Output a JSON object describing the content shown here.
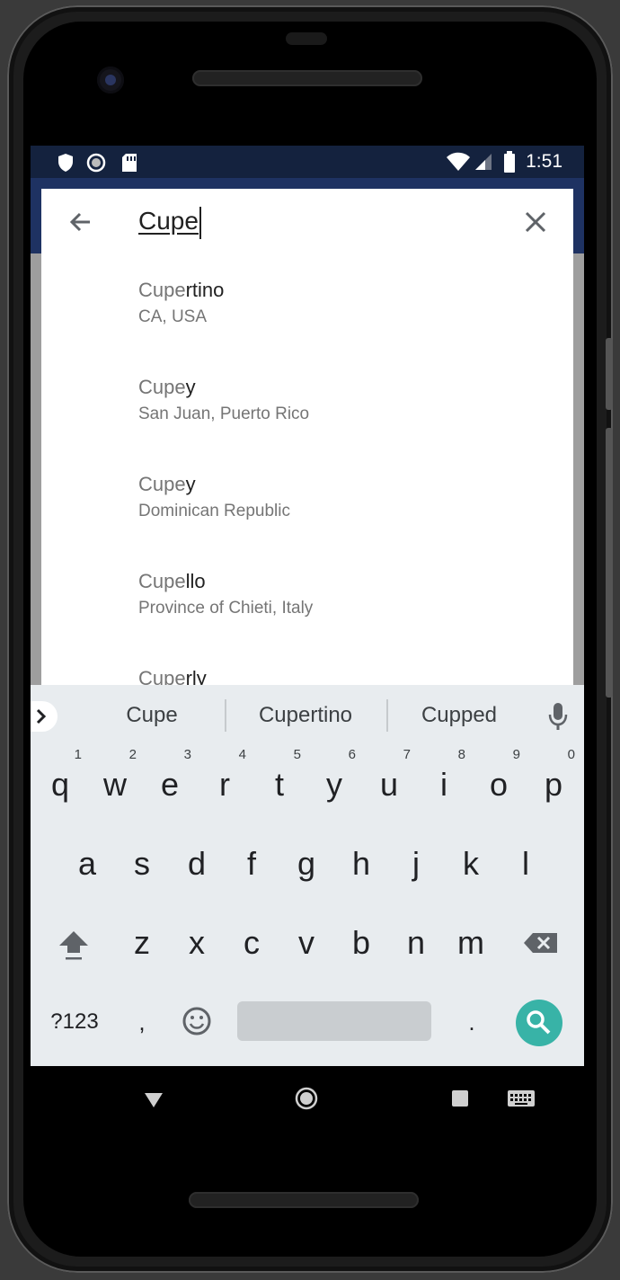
{
  "status_bar": {
    "time": "1:51",
    "left_icons": [
      "shield-icon",
      "sync-icon",
      "sd-card-icon"
    ],
    "right_icons": [
      "wifi-icon",
      "cell-signal-icon",
      "battery-icon"
    ]
  },
  "search": {
    "query": "Cupe"
  },
  "results": [
    {
      "match": "Cupe",
      "rest": "rtino",
      "subtitle": "CA, USA"
    },
    {
      "match": "Cupe",
      "rest": "y",
      "subtitle": "San Juan, Puerto Rico"
    },
    {
      "match": "Cupe",
      "rest": "y",
      "subtitle": "Dominican Republic"
    },
    {
      "match": "Cupe",
      "rest": "llo",
      "subtitle": "Province of Chieti, Italy"
    },
    {
      "match": "Cupe",
      "rest": "rly",
      "subtitle": ""
    }
  ],
  "keyboard": {
    "suggestions": [
      "Cupe",
      "Cupertino",
      "Cupped"
    ],
    "row1": [
      "q",
      "w",
      "e",
      "r",
      "t",
      "y",
      "u",
      "i",
      "o",
      "p"
    ],
    "row1_numbers": [
      "1",
      "2",
      "3",
      "4",
      "5",
      "6",
      "7",
      "8",
      "9",
      "0"
    ],
    "row2": [
      "a",
      "s",
      "d",
      "f",
      "g",
      "h",
      "j",
      "k",
      "l"
    ],
    "row3": [
      "z",
      "x",
      "c",
      "v",
      "b",
      "n",
      "m"
    ],
    "symbols_label": "?123",
    "comma": ",",
    "period": ".",
    "accent_color": "#38b3a7"
  },
  "colors": {
    "status_bar": "#14223e",
    "app_bar": "#1e3262",
    "keyboard_bg": "#e8ecef"
  }
}
